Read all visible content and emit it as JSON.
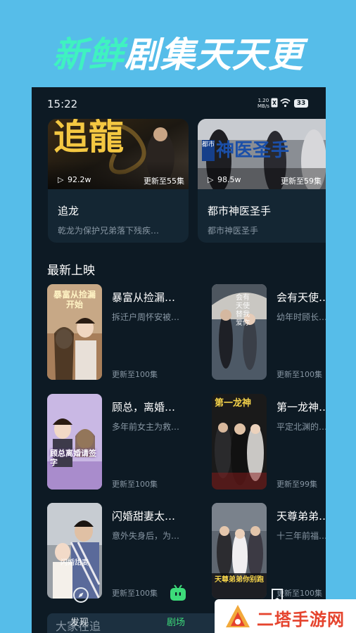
{
  "promo": {
    "highlight": "新鲜",
    "rest": "剧集天天更"
  },
  "status_bar": {
    "time": "15:22",
    "net_speed_value": "1.20",
    "net_speed_unit": "MB/s",
    "battery": "33"
  },
  "featured": [
    {
      "poster_text": "追龍",
      "views": "92.2w",
      "update": "更新至55集",
      "title": "追龙",
      "desc": "乾龙为保护兄弟落下残疾…"
    },
    {
      "poster_text": "神医圣手",
      "poster_small": "都市",
      "views": "98.5w",
      "update": "更新至59集",
      "title": "都市神医圣手",
      "desc": "都市神医圣手"
    }
  ],
  "section_title": "最新上映",
  "shows": [
    {
      "title": "暴富从捡漏…",
      "desc": "拆迁户周怀安被…",
      "update": "更新至100集",
      "cover_text": "暴富从捡漏开始"
    },
    {
      "title": "会有天使…",
      "desc": "幼年时顾长…",
      "update": "更新至100集",
      "cover_text": "会有天使替我爱你"
    },
    {
      "title": "顾总，离婚…",
      "desc": "多年前女主为救…",
      "update": "更新至100集",
      "cover_text": "顾总离婚请签字"
    },
    {
      "title": "第一龙神…",
      "desc": "平定北渊的…",
      "update": "更新至99集",
      "cover_text": "第一龙神"
    },
    {
      "title": "闪婚甜妻太…",
      "desc": "意外失身后，为…",
      "update": "更新至100集",
      "cover_text": "闪婚甜妻"
    },
    {
      "title": "天尊弟弟…",
      "desc": "十三年前福…",
      "update": "更新至100集",
      "cover_text": "天尊弟弟你别跑"
    }
  ],
  "tabs": [
    {
      "label": "发现",
      "icon": "compass-icon"
    },
    {
      "label": "剧场",
      "icon": "tv-icon"
    }
  ],
  "peek_text": "大家在追",
  "watermark": "二塔手游网",
  "colors": {
    "background": "#56bde9",
    "screen": "#0d1a24",
    "accent": "#3ff2c0",
    "tab_active": "#3ddc7a"
  }
}
